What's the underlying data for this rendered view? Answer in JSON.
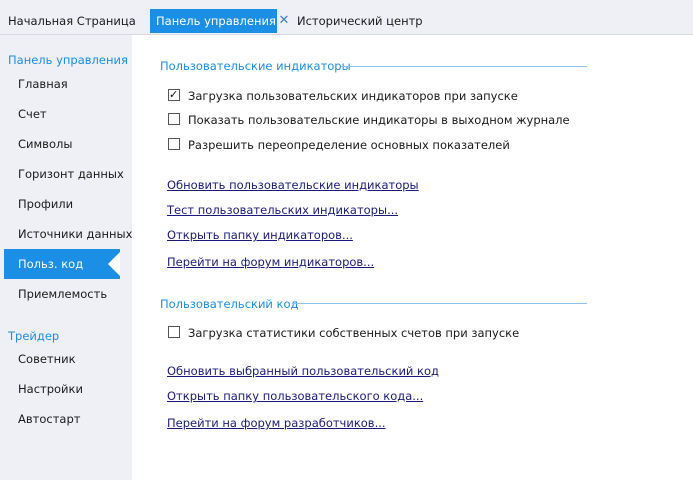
{
  "tabs": [
    {
      "label": "Начальная Страница"
    },
    {
      "label": "Панель управления"
    },
    {
      "label": "Исторический центр"
    }
  ],
  "sidebar": {
    "section1_title": "Панель управления",
    "items1": [
      "Главная",
      "Счет",
      "Символы",
      "Горизонт данных",
      "Профили",
      "Источники данных",
      "Польз. код",
      "Приемлемость"
    ],
    "active_item": "Польз. код",
    "section2_title": "Трейдер",
    "items2": [
      "Советник",
      "Настройки",
      "Автостарт"
    ]
  },
  "indicators": {
    "title": "Пользовательские индикаторы",
    "checkboxes": [
      {
        "label": "Загрузка пользовательских индикаторов при запуске",
        "checked": true
      },
      {
        "label": "Показать пользовательские индикаторы в выходном журнале",
        "checked": false
      },
      {
        "label": "Разрешить переопределение основных показателей",
        "checked": false
      }
    ],
    "links": [
      "Обновить пользовательские индикаторы",
      "Тест пользовательских индикаторы...",
      "Открыть папку индикаторов...",
      "Перейти на форум индикаторов..."
    ]
  },
  "custom_code": {
    "title": "Пользовательский код",
    "checkboxes": [
      {
        "label": "Загрузка статистики собственных счетов при запуске",
        "checked": false
      }
    ],
    "links": [
      "Обновить выбранный пользовательский код",
      "Открыть папку пользовательского кода...",
      "Перейти на форум разработчиков..."
    ]
  },
  "colors": {
    "accent": "#1b8ee5",
    "sidebar_bg": "#eef0f5",
    "link": "#1a1a7a"
  }
}
